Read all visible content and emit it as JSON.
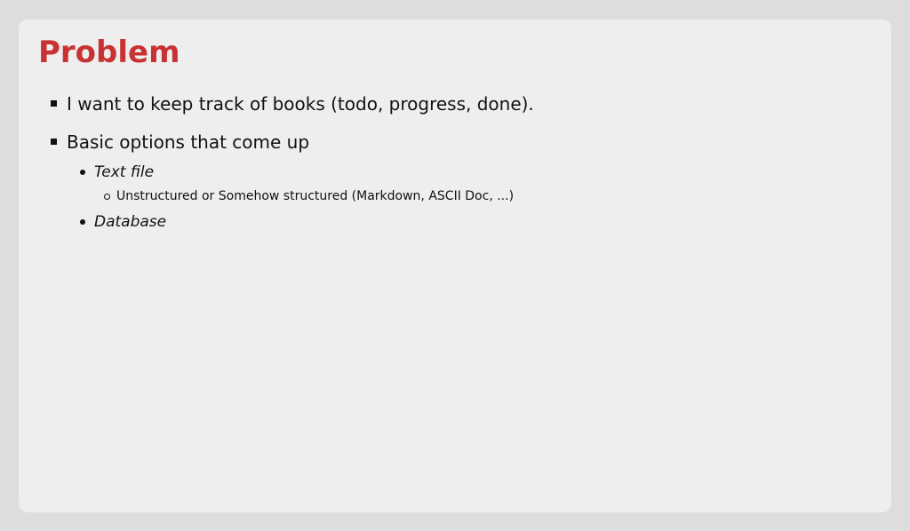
{
  "slide": {
    "title": "Problem",
    "title_color": "#c83232",
    "bullets": [
      {
        "text": "I want to keep track of books (todo, progress, done)."
      },
      {
        "text": "Basic options that come up",
        "sub": [
          {
            "text": "Text file",
            "sub": [
              {
                "text": "Unstructured or Somehow structured (Markdown, ASCII Doc, ...)"
              }
            ]
          },
          {
            "text": "Database"
          }
        ]
      }
    ]
  }
}
